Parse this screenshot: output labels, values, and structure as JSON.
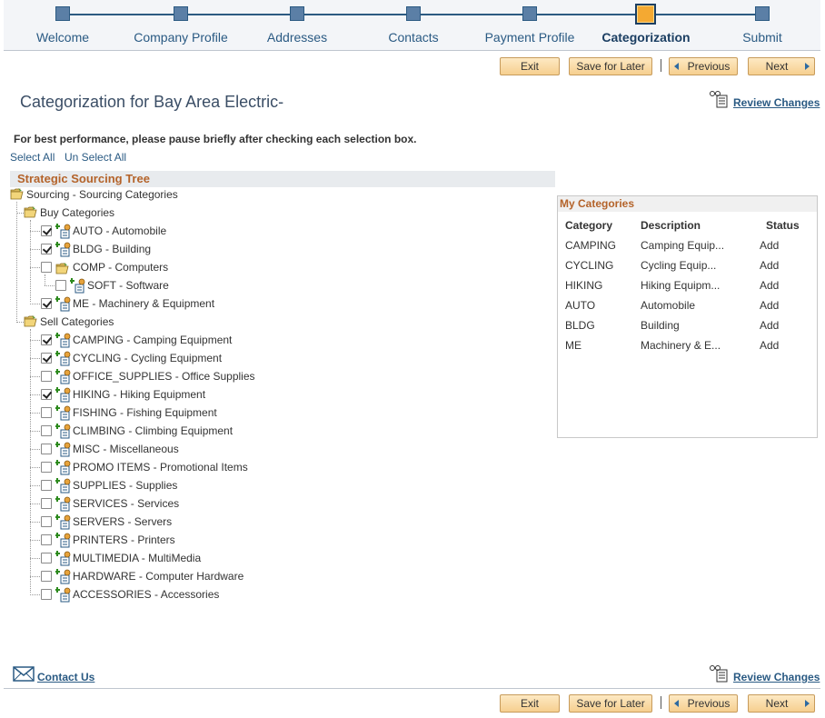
{
  "train": {
    "steps": [
      {
        "label": "Welcome"
      },
      {
        "label": "Company Profile"
      },
      {
        "label": "Addresses"
      },
      {
        "label": "Contacts"
      },
      {
        "label": "Payment Profile"
      },
      {
        "label": "Categorization"
      },
      {
        "label": "Submit"
      }
    ],
    "active_index": 5
  },
  "buttons": {
    "exit": "Exit",
    "save_later": "Save for Later",
    "previous": "Previous",
    "next": "Next"
  },
  "page": {
    "title": "Categorization for Bay Area Electric-",
    "review_changes": "Review Changes",
    "perf_note": "For best performance, please pause briefly after checking each selection box.",
    "select_all": "Select All",
    "unselect_all": "Un Select All",
    "contact_us": "Contact Us"
  },
  "tree": {
    "header": "Strategic Sourcing Tree",
    "root": "Sourcing - Sourcing Categories",
    "buy": {
      "label": "Buy Categories",
      "items": [
        {
          "label": "AUTO - Automobile",
          "checked": true
        },
        {
          "label": "BLDG - Building",
          "checked": true
        },
        {
          "label": "COMP - Computers",
          "checked": false,
          "folder": true
        },
        {
          "label": "SOFT - Software",
          "checked": false,
          "child": true
        },
        {
          "label": "ME - Machinery & Equipment",
          "checked": true
        }
      ]
    },
    "sell": {
      "label": "Sell Categories",
      "items": [
        {
          "label": "CAMPING - Camping Equipment",
          "checked": true
        },
        {
          "label": "CYCLING - Cycling Equipment",
          "checked": true
        },
        {
          "label": "OFFICE_SUPPLIES - Office Supplies",
          "checked": false
        },
        {
          "label": "HIKING - Hiking Equipment",
          "checked": true
        },
        {
          "label": "FISHING - Fishing Equipment",
          "checked": false
        },
        {
          "label": "CLIMBING - Climbing Equipment",
          "checked": false
        },
        {
          "label": "MISC - Miscellaneous",
          "checked": false
        },
        {
          "label": "PROMO ITEMS - Promotional Items",
          "checked": false
        },
        {
          "label": "SUPPLIES - Supplies",
          "checked": false
        },
        {
          "label": "SERVICES - Services",
          "checked": false
        },
        {
          "label": "SERVERS - Servers",
          "checked": false
        },
        {
          "label": "PRINTERS - Printers",
          "checked": false
        },
        {
          "label": "MULTIMEDIA - MultiMedia",
          "checked": false
        },
        {
          "label": "HARDWARE - Computer Hardware",
          "checked": false
        },
        {
          "label": "ACCESSORIES - Accessories",
          "checked": false
        }
      ]
    }
  },
  "my_categories": {
    "title": "My Categories",
    "columns": [
      "Category",
      "Description",
      "Status"
    ],
    "rows": [
      [
        "CAMPING",
        "Camping Equip...",
        "Add"
      ],
      [
        "CYCLING",
        "Cycling Equip...",
        "Add"
      ],
      [
        "HIKING",
        "Hiking Equipm...",
        "Add"
      ],
      [
        "AUTO",
        "Automobile",
        "Add"
      ],
      [
        "BLDG",
        "Building",
        "Add"
      ],
      [
        "ME",
        "Machinery & E...",
        "Add"
      ]
    ]
  },
  "colors": {
    "link": "#2a5a83",
    "accent_orange": "#b4632a",
    "active_step": "#f4a932",
    "button_bg": "#f6cf8f"
  }
}
